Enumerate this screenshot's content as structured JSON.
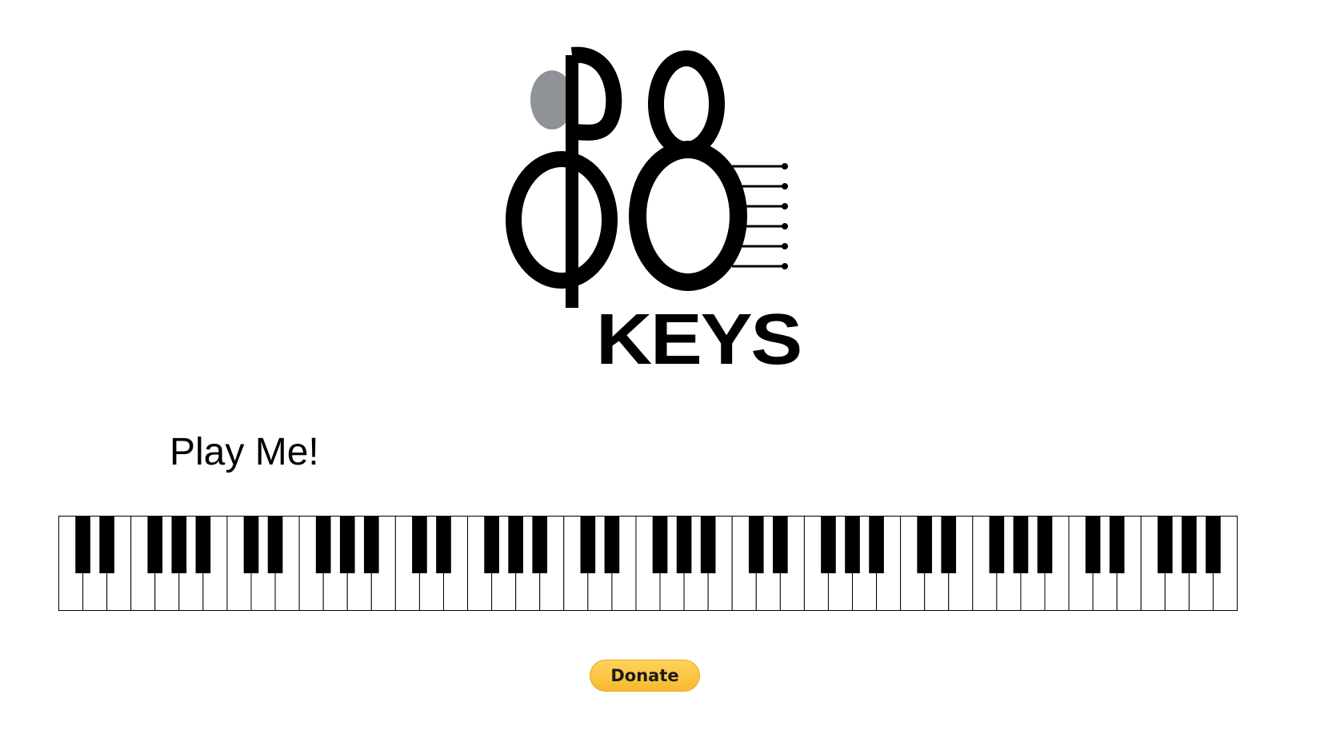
{
  "logo": {
    "text": "KEYS",
    "alt": "88 KEYS"
  },
  "colors": {
    "accent_gray": "#8f9296",
    "donate_yellow": "#ffc439"
  },
  "play_label": "Play Me!",
  "keyboard": {
    "white_key_count": 49,
    "black_key_pattern": [
      1,
      1,
      0,
      1,
      1,
      1,
      0
    ]
  },
  "donate_label": "Donate"
}
